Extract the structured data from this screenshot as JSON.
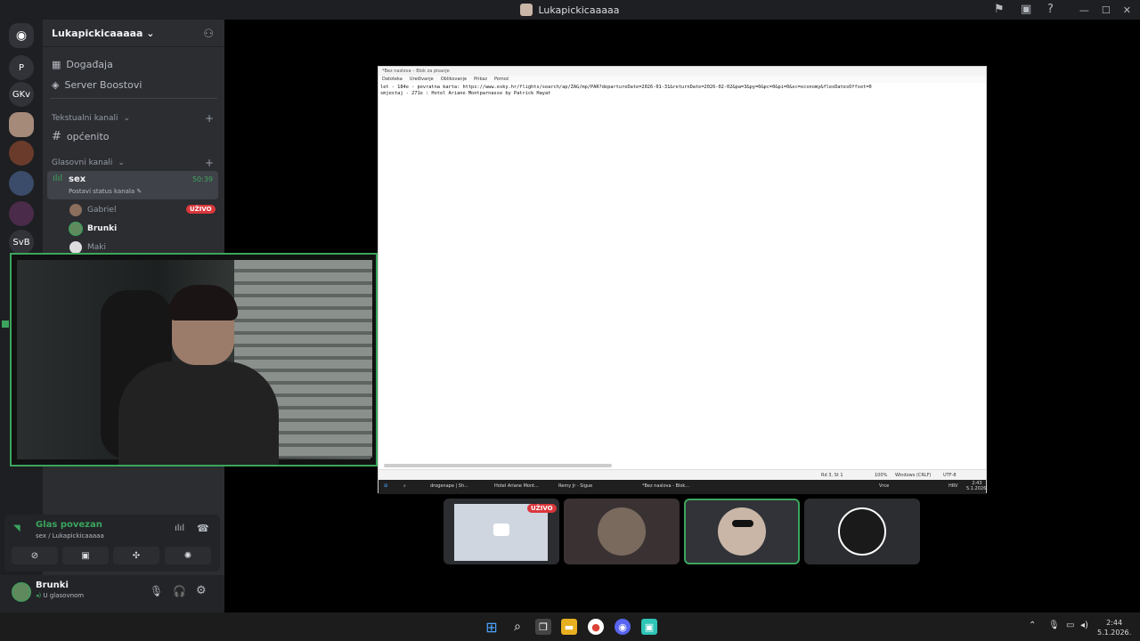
{
  "window": {
    "title": "Lukapickicaaaaa"
  },
  "rail": {
    "servers": [
      "P",
      "GKv",
      "SvB"
    ]
  },
  "sidebar": {
    "server_name": "Lukapickicaaaaa",
    "events_label": "Događaja",
    "boosts_label": "Server Boostovi",
    "text_category": "Tekstualni kanali",
    "text_channel": "općenito",
    "voice_category": "Glasovni kanali",
    "voice_channel": {
      "name": "sex",
      "timer": "50:39",
      "status": "Postavi status kanala"
    },
    "members": [
      {
        "name": "Gabriel",
        "badge": "UŽIVO"
      },
      {
        "name": "Brunki"
      },
      {
        "name": "Maki"
      }
    ]
  },
  "voice_panel": {
    "status": "Glas povezan",
    "channel_path": "sex / Lukapickicaaaaa"
  },
  "user_panel": {
    "name": "Brunki",
    "status": "U glasovnom"
  },
  "stream": {
    "title": "*Bez naslova – Blok za pisanje",
    "menu": [
      "Datoteka",
      "Uređivanje",
      "Oblikovanje",
      "Prikaz",
      "Pomoć"
    ],
    "lines": [
      "let - 184e - povratna karta: https://www.esky.hr/flights/search/ap/ZAG/mp/PAR?departureDate=2026-01-31&returnDate=2026-02-02&pa=3&py=0&pc=0&pi=0&sc=economy&flexDatesOffset=0",
      "smjestaj - 271e : Hotel Ariane Montparnasse by Patrick Hayat"
    ],
    "status": {
      "pos": "Rd 3, St 1",
      "zoom": "100%",
      "eol": "Windows (CRLF)",
      "enc": "UTF-8"
    },
    "taskbar": [
      "drogenape | Sh...",
      "Hotel Ariane Mont...",
      "Remy Jr - Sigue",
      "*Bez naslova - Blok..."
    ],
    "clock": {
      "time": "2:43",
      "date": "5.1.2026.",
      "lang": "HRV",
      "weather": "Vrce"
    }
  },
  "tiles": [
    {
      "badge": "UŽIVO"
    }
  ],
  "taskbar": {
    "time": "2:44",
    "date": "5.1.2026."
  }
}
